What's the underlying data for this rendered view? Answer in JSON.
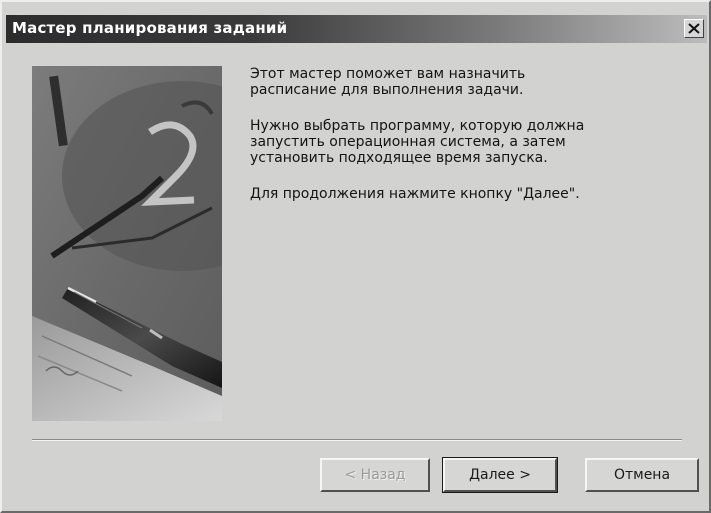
{
  "window": {
    "title": "Мастер планирования заданий",
    "close_icon": "close-icon"
  },
  "art": {
    "description_icon": "wizard-illustration-clock-pen"
  },
  "content": {
    "paragraph1": "Этот мастер поможет вам назначить\nрасписание для выполнения задачи.",
    "paragraph2": "Нужно выбрать программу, которую должна\nзапустить операционная система, а затем\nустановить подходящее время запуска.",
    "paragraph3": "Для продолжения нажмите кнопку \"Далее\"."
  },
  "buttons": {
    "back": "< Назад",
    "next": "Далее >",
    "cancel": "Отмена",
    "back_enabled": false
  },
  "colors": {
    "titlebar_start": "#2c2c2c",
    "titlebar_end": "#bcbcbc",
    "dialog_bg": "#d2d2d0"
  }
}
